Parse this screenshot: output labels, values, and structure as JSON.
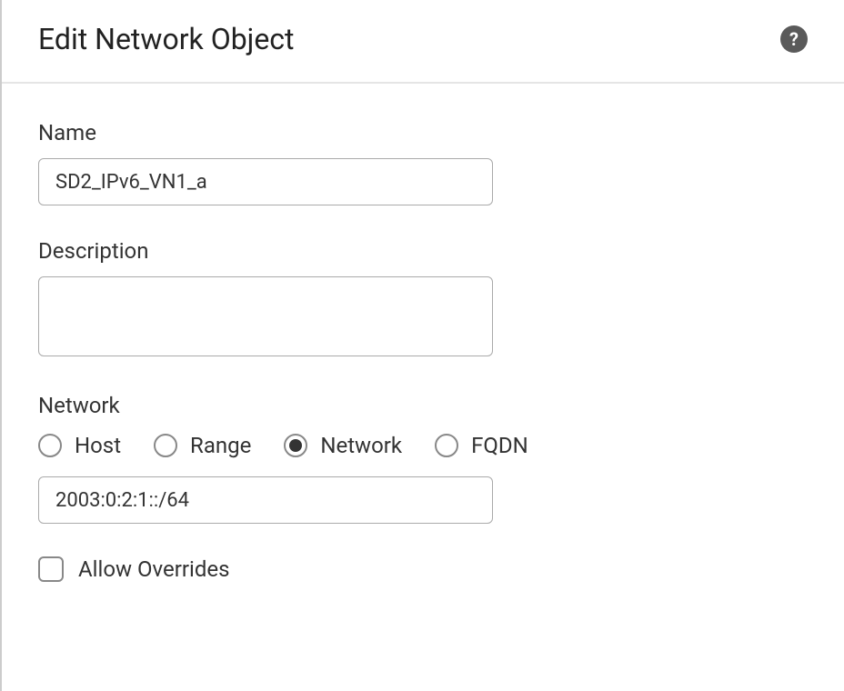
{
  "header": {
    "title": "Edit Network Object",
    "help_glyph": "?"
  },
  "form": {
    "name_label": "Name",
    "name_value": "SD2_IPv6_VN1_a",
    "description_label": "Description",
    "description_value": "",
    "network_label": "Network",
    "radio_options": {
      "host": "Host",
      "range": "Range",
      "network": "Network",
      "fqdn": "FQDN"
    },
    "network_value": "2003:0:2:1::/64",
    "allow_overrides_label": "Allow Overrides"
  }
}
